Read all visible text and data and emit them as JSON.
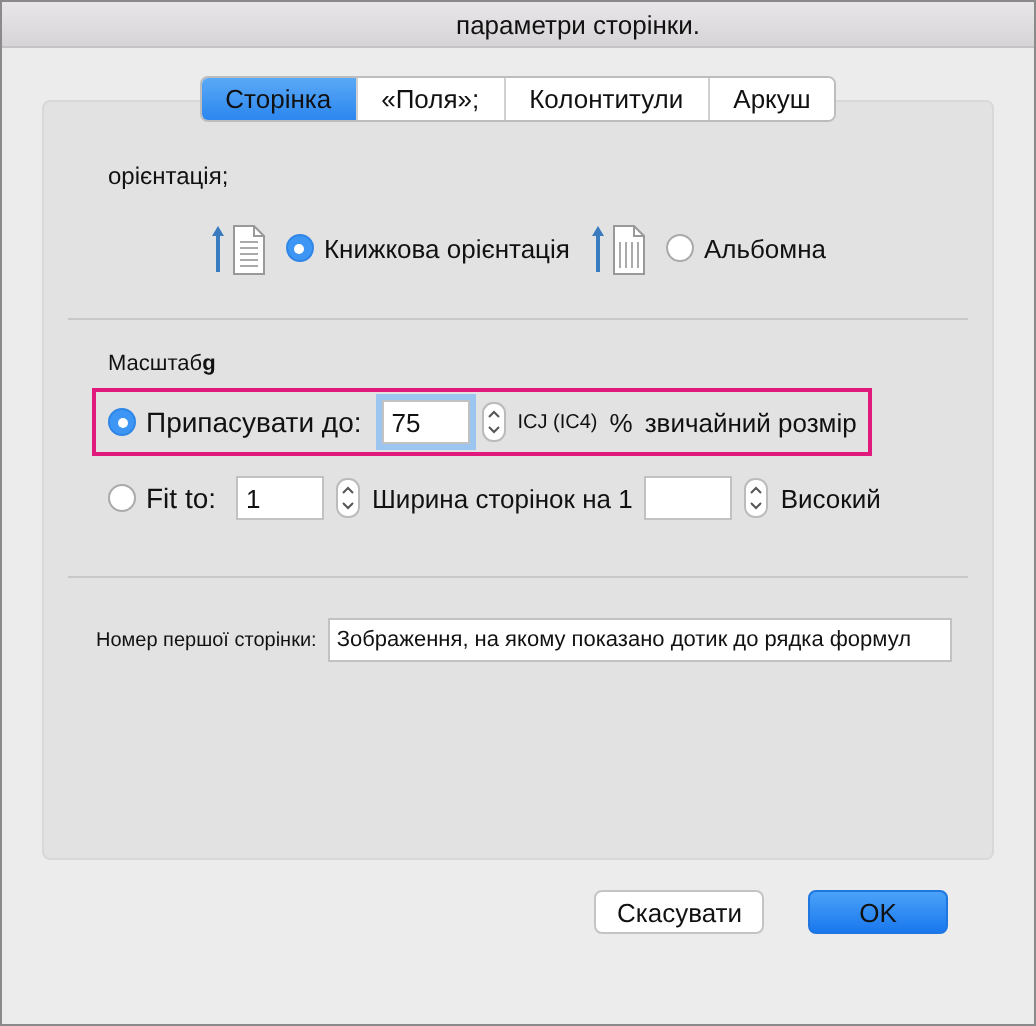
{
  "window": {
    "title": "параметри сторінки."
  },
  "tabs": [
    {
      "label": "Сторінка",
      "selected": true
    },
    {
      "label": "«Поля»;",
      "selected": false
    },
    {
      "label": "Колонтитули",
      "selected": false
    },
    {
      "label": "Аркуш",
      "selected": false
    }
  ],
  "orientation": {
    "label": "орієнтація;",
    "options": [
      {
        "label": "Книжкова орієнтація",
        "kind": "portrait",
        "selected": true
      },
      {
        "label": "Альбомна",
        "kind": "landscape",
        "selected": false
      }
    ]
  },
  "scaling": {
    "label": "Масштаб**g**",
    "rows": [
      {
        "highlighted": true,
        "label": "Припасувати до:",
        "selected": true,
        "items": [
          {
            "kind": "field",
            "value": "75"
          },
          {
            "kind": "stepper"
          },
          {
            "kind": "small",
            "text": "ICJ (IC4)"
          },
          {
            "kind": "label",
            "text": "%"
          },
          {
            "kind": "label",
            "text": "звичайний розмір"
          }
        ]
      },
      {
        "highlighted": false,
        "label": "Fit to:",
        "selected": false,
        "items": [
          {
            "kind": "field",
            "value": "1"
          },
          {
            "kind": "stepper"
          },
          {
            "kind": "label",
            "text": "Ширина сторінок на 1"
          },
          {
            "kind": "field"
          },
          {
            "kind": "stepper"
          },
          {
            "kind": "label",
            "text": "Високий"
          }
        ]
      }
    ]
  },
  "first_page_number": {
    "label": "Номер першої сторінки:",
    "value": "Зображення, на якому показано дотик до рядка формул"
  },
  "buttons": [
    {
      "label": "Скасувати",
      "default": false
    },
    {
      "label": "OK",
      "default": true
    }
  ]
}
